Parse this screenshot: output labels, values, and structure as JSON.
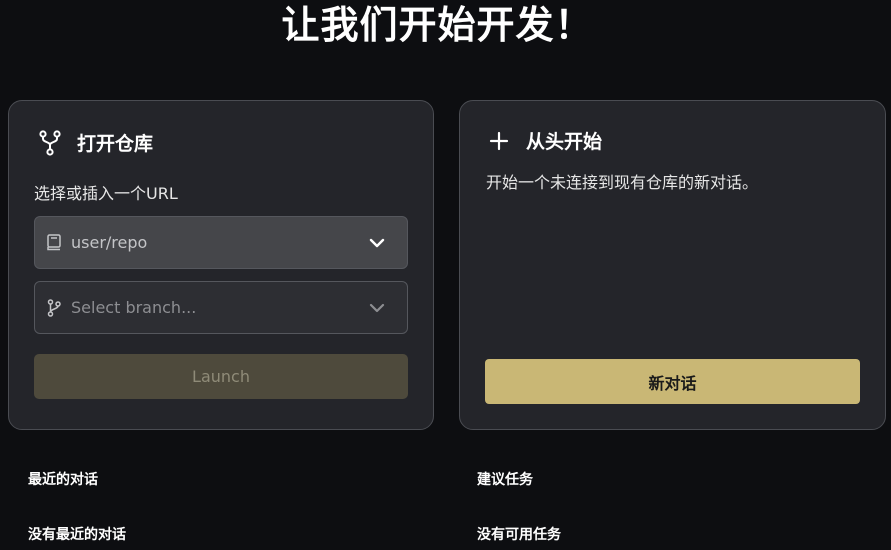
{
  "page_title": "让我们开始开发！",
  "open_repo": {
    "title": "打开仓库",
    "icon": "git-fork-icon",
    "label": "选择或插入一个URL",
    "repo_select": {
      "value": "user/repo",
      "icon": "repo-book-icon"
    },
    "branch_select": {
      "placeholder": "Select branch...",
      "icon": "git-branch-icon"
    },
    "launch_label": "Launch"
  },
  "from_scratch": {
    "title": "从头开始",
    "icon": "plus-icon",
    "description": "开始一个未连接到现有仓库的新对话。",
    "new_conversation_label": "新对话"
  },
  "recent": {
    "title": "最近的对话",
    "empty": "没有最近的对话"
  },
  "suggested": {
    "title": "建议任务",
    "empty": "没有可用任务"
  },
  "colors": {
    "background": "#0d0e11",
    "card": "#24252a",
    "accent": "#c9b775",
    "launch_disabled": "#4e4a3c"
  }
}
